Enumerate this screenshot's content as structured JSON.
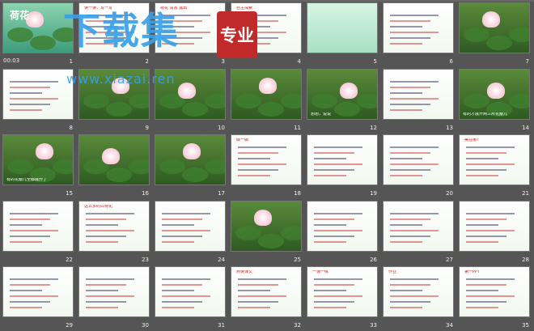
{
  "app": {
    "view": "slide sorter",
    "first_slide_label": "00:03"
  },
  "slides": [
    {
      "n": "1",
      "kind": "title",
      "text": "荷花"
    },
    {
      "n": "2",
      "kind": "text",
      "text": "读一读，写一写"
    },
    {
      "n": "3",
      "kind": "text",
      "text": "荷花 清香 露出"
    },
    {
      "n": "4",
      "kind": "text",
      "text": "自主探索"
    },
    {
      "n": "5",
      "kind": "green",
      "text": ""
    },
    {
      "n": "6",
      "kind": "text",
      "text": ""
    },
    {
      "n": "7",
      "kind": "lotus",
      "text": ""
    },
    {
      "n": "8",
      "kind": "text",
      "text": ""
    },
    {
      "n": "9",
      "kind": "lotus",
      "text": ""
    },
    {
      "n": "10",
      "kind": "lotus",
      "text": ""
    },
    {
      "n": "11",
      "kind": "lotus",
      "text": ""
    },
    {
      "n": "12",
      "kind": "lotus",
      "text": "想想，说说"
    },
    {
      "n": "13",
      "kind": "text",
      "text": ""
    },
    {
      "n": "14",
      "kind": "lotus",
      "text": "有的才展开两三片花瓣儿"
    },
    {
      "n": "15",
      "kind": "lotus",
      "text": "有的花瓣儿全都展开了"
    },
    {
      "n": "16",
      "kind": "lotus",
      "text": ""
    },
    {
      "n": "17",
      "kind": "lotus",
      "text": ""
    },
    {
      "n": "18",
      "kind": "text",
      "text": "做一做"
    },
    {
      "n": "19",
      "kind": "text",
      "text": ""
    },
    {
      "n": "20",
      "kind": "text",
      "text": ""
    },
    {
      "n": "21",
      "kind": "text",
      "text": "美在哪？"
    },
    {
      "n": "22",
      "kind": "text",
      "text": ""
    },
    {
      "n": "23",
      "kind": "text",
      "text": "这么多的白荷花"
    },
    {
      "n": "24",
      "kind": "text",
      "text": ""
    },
    {
      "n": "25",
      "kind": "lotus",
      "text": ""
    },
    {
      "n": "26",
      "kind": "text",
      "text": ""
    },
    {
      "n": "27",
      "kind": "text",
      "text": ""
    },
    {
      "n": "28",
      "kind": "text",
      "text": ""
    },
    {
      "n": "29",
      "kind": "text",
      "text": ""
    },
    {
      "n": "30",
      "kind": "text",
      "text": ""
    },
    {
      "n": "31",
      "kind": "text",
      "text": ""
    },
    {
      "n": "32",
      "kind": "text",
      "text": "熟读课文"
    },
    {
      "n": "33",
      "kind": "text",
      "text": "一课一练"
    },
    {
      "n": "34",
      "kind": "text",
      "text": "作业"
    },
    {
      "n": "35",
      "kind": "text",
      "text": "第一PPT"
    }
  ],
  "watermark": {
    "brand": "下载集",
    "badge": "专业",
    "url": "www.xiazai.ren"
  },
  "colors": {
    "background": "#555555",
    "slide_number": "#eeeeee",
    "accent_red": "#cc2222",
    "watermark_blue": "#3aa0e8"
  }
}
